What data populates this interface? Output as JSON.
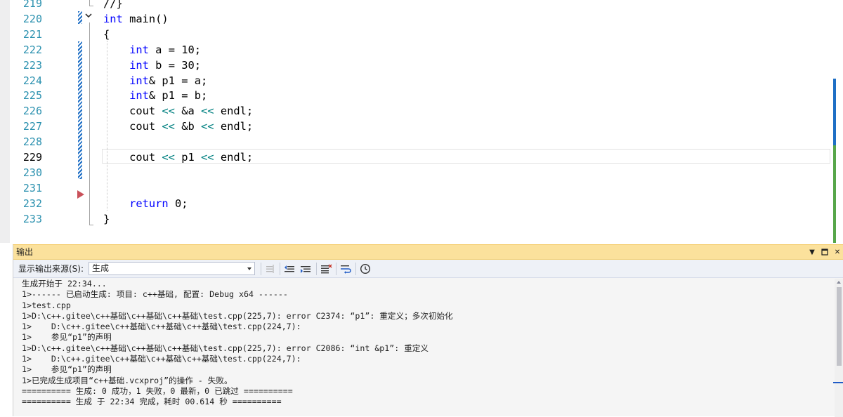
{
  "editor": {
    "lines": [
      {
        "num": "219",
        "code": [
          {
            "t": "//}",
            "c": "plain"
          }
        ]
      },
      {
        "num": "220",
        "code": [
          {
            "t": "int",
            "c": "kw"
          },
          {
            "t": " main()",
            "c": "plain"
          }
        ]
      },
      {
        "num": "221",
        "code": [
          {
            "t": "{",
            "c": "plain"
          }
        ]
      },
      {
        "num": "222",
        "code": [
          {
            "t": "    ",
            "c": "plain"
          },
          {
            "t": "int",
            "c": "kw"
          },
          {
            "t": " a = 10;",
            "c": "plain"
          }
        ]
      },
      {
        "num": "223",
        "code": [
          {
            "t": "    ",
            "c": "plain"
          },
          {
            "t": "int",
            "c": "kw"
          },
          {
            "t": " b = 30;",
            "c": "plain"
          }
        ]
      },
      {
        "num": "224",
        "code": [
          {
            "t": "    ",
            "c": "plain"
          },
          {
            "t": "int",
            "c": "kw"
          },
          {
            "t": "& p1 = a;",
            "c": "plain"
          }
        ]
      },
      {
        "num": "225",
        "code": [
          {
            "t": "    ",
            "c": "plain"
          },
          {
            "t": "int",
            "c": "kw"
          },
          {
            "t": "& p1 = b;",
            "c": "plain"
          }
        ]
      },
      {
        "num": "226",
        "code": [
          {
            "t": "    cout ",
            "c": "plain"
          },
          {
            "t": "<<",
            "c": "op"
          },
          {
            "t": " &a ",
            "c": "plain"
          },
          {
            "t": "<<",
            "c": "op"
          },
          {
            "t": " endl;",
            "c": "plain"
          }
        ]
      },
      {
        "num": "227",
        "code": [
          {
            "t": "    cout ",
            "c": "plain"
          },
          {
            "t": "<<",
            "c": "op"
          },
          {
            "t": " &b ",
            "c": "plain"
          },
          {
            "t": "<<",
            "c": "op"
          },
          {
            "t": " endl;",
            "c": "plain"
          }
        ]
      },
      {
        "num": "228",
        "code": []
      },
      {
        "num": "229",
        "code": [
          {
            "t": "    cout ",
            "c": "plain"
          },
          {
            "t": "<<",
            "c": "op"
          },
          {
            "t": " p1 ",
            "c": "plain"
          },
          {
            "t": "<<",
            "c": "op"
          },
          {
            "t": " endl;",
            "c": "plain"
          }
        ]
      },
      {
        "num": "230",
        "code": []
      },
      {
        "num": "231",
        "code": []
      },
      {
        "num": "232",
        "code": [
          {
            "t": "    ",
            "c": "plain"
          },
          {
            "t": "return",
            "c": "kw"
          },
          {
            "t": " 0;",
            "c": "plain"
          }
        ]
      },
      {
        "num": "233",
        "code": [
          {
            "t": "}",
            "c": "plain"
          }
        ]
      }
    ],
    "current_line": "229"
  },
  "output": {
    "title": "输出",
    "source_label": "显示输出来源(S):",
    "source_value": "生成",
    "text": "生成开始于 22:34...\n1>------ 已启动生成: 项目: c++基础, 配置: Debug x64 ------\n1>test.cpp\n1>D:\\c++.gitee\\c++基础\\c++基础\\c++基础\\test.cpp(225,7): error C2374: “p1”: 重定义；多次初始化\n1>    D:\\c++.gitee\\c++基础\\c++基础\\c++基础\\test.cpp(224,7):\n1>    参见“p1”的声明\n1>D:\\c++.gitee\\c++基础\\c++基础\\c++基础\\test.cpp(225,7): error C2086: “int &p1”: 重定义\n1>    D:\\c++.gitee\\c++基础\\c++基础\\c++基础\\test.cpp(224,7):\n1>    参见“p1”的声明\n1>已完成生成项目“c++基础.vcxproj”的操作 - 失败。\n========== 生成: 0 成功，1 失败，0 最新，0 已跳过 ==========\n========== 生成 于 22:34 完成，耗时 00.614 秒 =========="
  },
  "icons": {
    "collapse": "chevron-down-icon",
    "breakpoint_arrow": "next-statement-arrow-icon",
    "toolbar": [
      "find-message-icon",
      "prev-message-icon",
      "next-message-icon",
      "clear-all-icon",
      "word-wrap-icon",
      "show-timestamps-icon"
    ],
    "window": [
      "window-menu-icon",
      "maximize-icon",
      "close-icon"
    ]
  },
  "colors": {
    "keyword": "#0000ff",
    "operator": "#008080",
    "line_number": "#2b91af",
    "change_bar": "#1f6fc5",
    "panel_title_bg": "#fbe19c",
    "breakpoint": "#c9515a"
  }
}
